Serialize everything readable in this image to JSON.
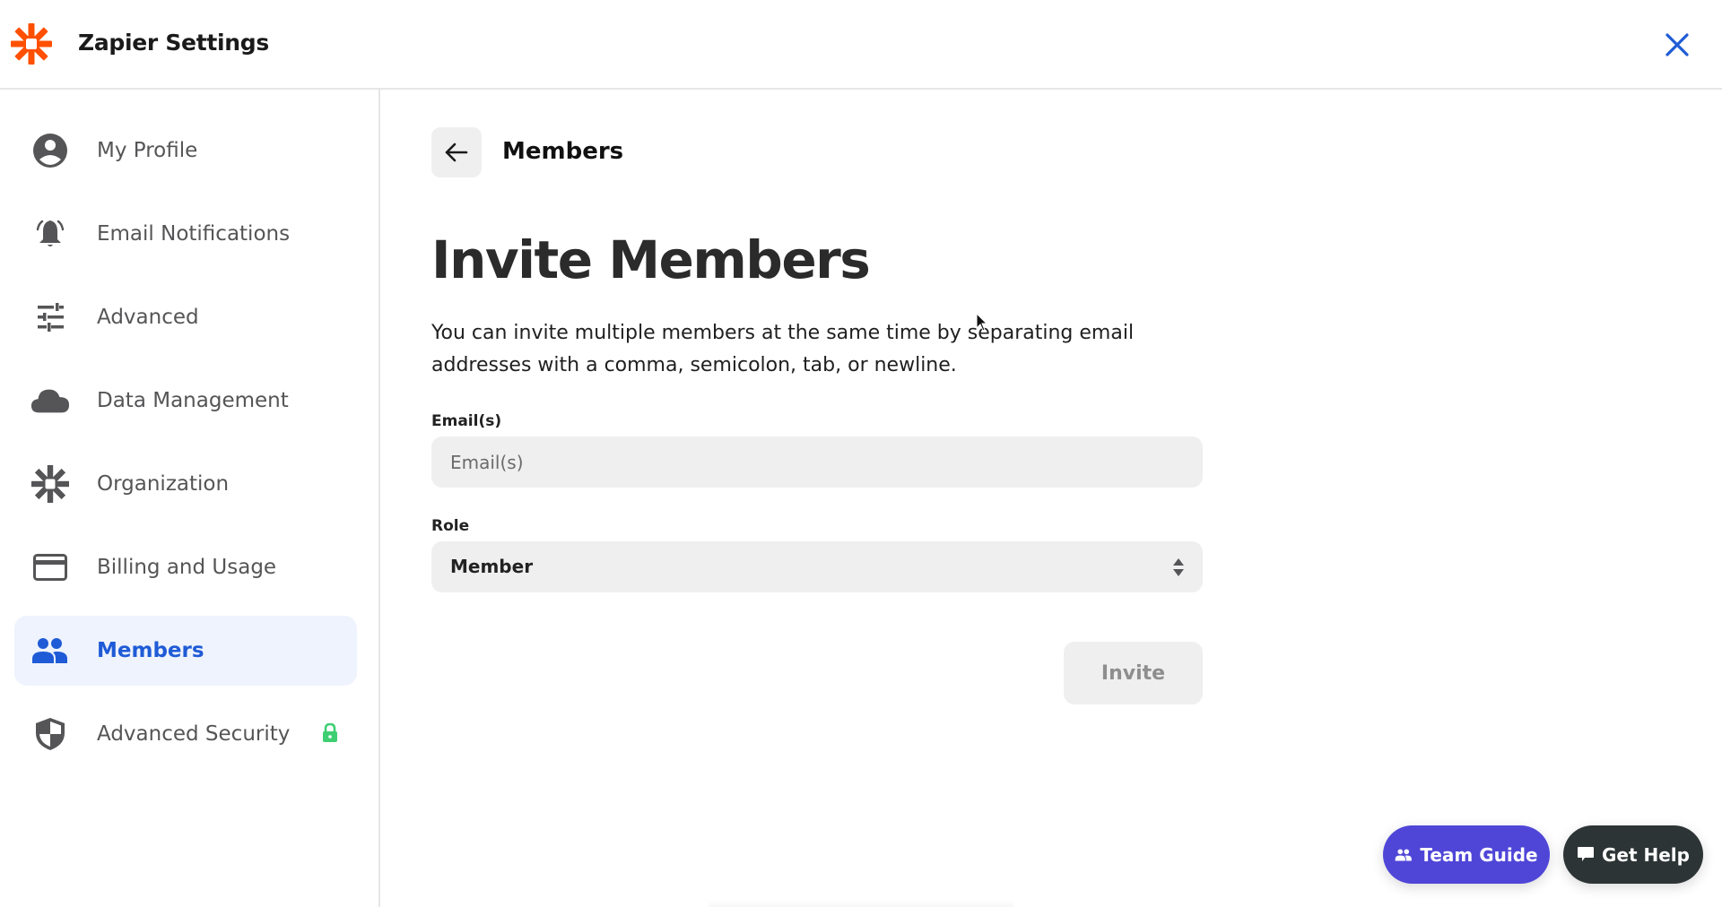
{
  "app": {
    "title": "Zapier Settings",
    "logo_icon": "zapier-asterisk-logo",
    "close_icon": "close-x-icon",
    "brand_color": "#ff4f00",
    "accent_color": "#1f5bd6"
  },
  "sidebar": {
    "items": [
      {
        "label": "My Profile",
        "icon": "user-circle-icon",
        "active": false
      },
      {
        "label": "Email Notifications",
        "icon": "bell-ringing-icon",
        "active": false
      },
      {
        "label": "Advanced",
        "icon": "sliders-icon",
        "active": false
      },
      {
        "label": "Data Management",
        "icon": "cloud-icon",
        "active": false
      },
      {
        "label": "Organization",
        "icon": "asterisk-icon",
        "active": false
      },
      {
        "label": "Billing and Usage",
        "icon": "credit-card-icon",
        "active": false
      },
      {
        "label": "Members",
        "icon": "people-icon",
        "active": true
      },
      {
        "label": "Advanced Security",
        "icon": "shield-icon",
        "active": false,
        "badge_icon": "lock-icon",
        "badge_color": "#3ecf72"
      }
    ]
  },
  "main": {
    "back_icon": "arrow-left-icon",
    "breadcrumb": "Members",
    "title": "Invite Members",
    "description": "You can invite multiple members at the same time by separating email addresses with a comma, semicolon, tab, or newline.",
    "form": {
      "email_label": "Email(s)",
      "email_placeholder": "Email(s)",
      "email_value": "",
      "role_label": "Role",
      "role_value": "Member",
      "invite_label": "Invite"
    }
  },
  "floating": {
    "team_guide_label": "Team Guide",
    "team_guide_color": "#4f46d8",
    "get_help_label": "Get Help",
    "get_help_color": "#2d3435"
  }
}
